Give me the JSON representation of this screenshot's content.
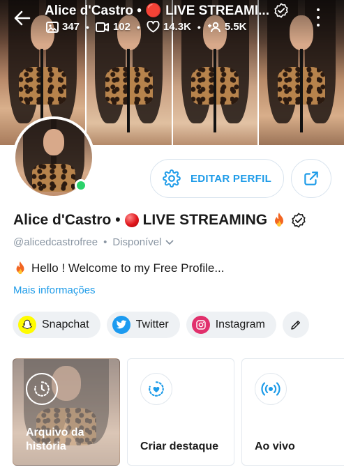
{
  "header": {
    "title": "Alice d'Castro • 🔴 LIVE STREAMI...",
    "stats": {
      "photos": "347",
      "videos": "102",
      "likes": "14.3K",
      "fans": "5.5K"
    }
  },
  "profile": {
    "name_prefix": "Alice d'Castro •",
    "name_suffix": "LIVE STREAMING",
    "handle": "@alicedcastrofree",
    "separator": "•",
    "availability": "Disponível",
    "bio": "Hello ! Welcome to my Free Profile...",
    "more_info": "Mais informações",
    "online": true
  },
  "actions": {
    "edit_profile": "EDITAR PERFIL"
  },
  "socials": [
    {
      "label": "Snapchat",
      "color": "#fffc00"
    },
    {
      "label": "Twitter",
      "color": "#1d9bf0"
    },
    {
      "label": "Instagram",
      "color": "#e1306c"
    }
  ],
  "highlights": [
    {
      "label_line1": "Arquivo da",
      "label_line2": "história"
    },
    {
      "label": "Criar destaque"
    },
    {
      "label": "Ao vivo"
    }
  ],
  "colors": {
    "accent": "#1d9be8",
    "muted": "#8a96a3",
    "online": "#2bd26b",
    "live_red": "#e0151b"
  }
}
